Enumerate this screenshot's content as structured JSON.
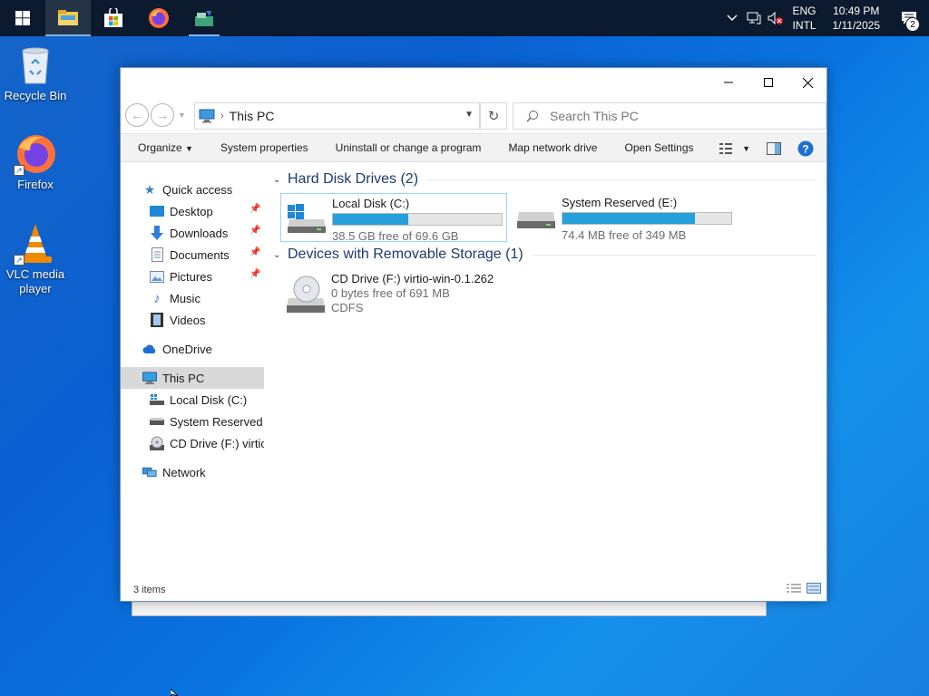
{
  "taskbar": {
    "apps": [
      "start",
      "file-explorer",
      "microsoft-store",
      "firefox",
      "installer"
    ],
    "tray": {
      "lang_line1": "ENG",
      "lang_line2": "INTL",
      "time": "10:49 PM",
      "date": "1/11/2025",
      "notification_count": "2"
    }
  },
  "desktop": {
    "icons": [
      {
        "label": "Recycle Bin"
      },
      {
        "label": "Firefox"
      },
      {
        "label": "VLC media player"
      }
    ]
  },
  "explorer": {
    "address": {
      "location": "This PC"
    },
    "search": {
      "placeholder": "Search This PC"
    },
    "commands": {
      "organize": "Organize",
      "system_properties": "System properties",
      "uninstall": "Uninstall or change a program",
      "map_drive": "Map network drive",
      "open_settings": "Open Settings"
    },
    "nav": {
      "quick_access": "Quick access",
      "desktop": "Desktop",
      "downloads": "Downloads",
      "documents": "Documents",
      "pictures": "Pictures",
      "music": "Music",
      "videos": "Videos",
      "onedrive": "OneDrive",
      "this_pc": "This PC",
      "local_disk": "Local Disk (C:)",
      "system_reserved": "System Reserved",
      "cd_drive": "CD Drive (F:) virtio",
      "network": "Network"
    },
    "groups": {
      "hdd": "Hard Disk Drives (2)",
      "removable": "Devices with Removable Storage (1)"
    },
    "drives": {
      "c": {
        "name": "Local Disk (C:)",
        "free": "38.5 GB free of 69.6 GB",
        "used_fraction": 0.447
      },
      "e": {
        "name": "System Reserved (E:)",
        "free": "74.4 MB free of 349 MB",
        "used_fraction": 0.787
      },
      "f": {
        "name": "CD Drive (F:) virtio-win-0.1.262",
        "free": "0 bytes free of 691 MB",
        "fs": "CDFS"
      }
    },
    "status": {
      "items": "3 items"
    }
  },
  "colors": {
    "accent": "#26a0da",
    "taskbar": "#0b1a2e",
    "selection": "#d9d9d9"
  }
}
